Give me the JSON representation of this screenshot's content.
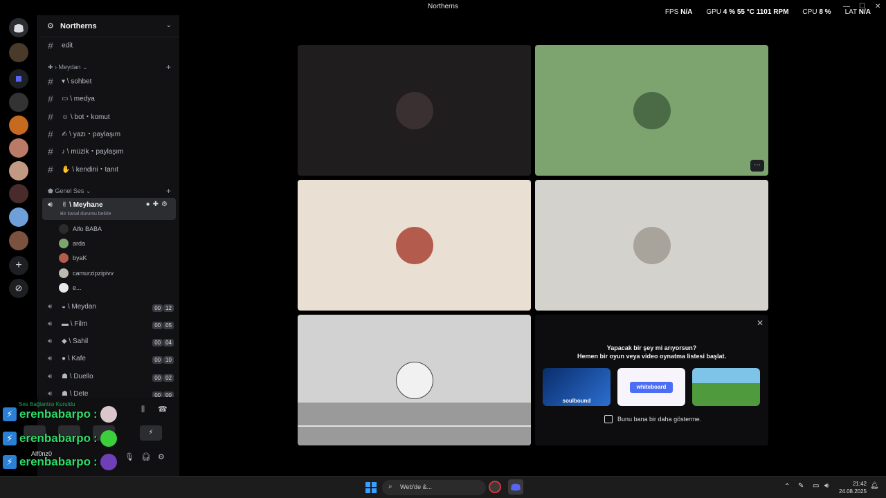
{
  "window": {
    "title": "Northerns"
  },
  "overlay": {
    "fps_label": "FPS",
    "fps_value": "N/A",
    "gpu_label": "GPU",
    "gpu_pct": "4 %",
    "gpu_temp": "55 °C",
    "gpu_rpm": "1101 RPM",
    "cpu_label": "CPU",
    "cpu_pct": "8 %",
    "lat_label": "LAT",
    "lat_value": "N/A"
  },
  "server": {
    "name": "Northerns"
  },
  "channels_top": [
    {
      "label": "edit"
    }
  ],
  "categories": [
    {
      "label": "Meydan"
    },
    {
      "label": "Genel Ses"
    }
  ],
  "text_channels": [
    {
      "label": "sohbet"
    },
    {
      "label": "medya"
    },
    {
      "label": "bot・komut"
    },
    {
      "label": "yazı・paylaşım"
    },
    {
      "label": "müzik・paylaşım"
    },
    {
      "label": "kendini・tanıt"
    }
  ],
  "active_voice": {
    "label": "Meyhane",
    "status": "Bir kanal durumu belirle"
  },
  "members": [
    {
      "name": "Alfo BABA"
    },
    {
      "name": "arda"
    },
    {
      "name": "byaK"
    },
    {
      "name": "camurzipzipivv"
    },
    {
      "name": "e..."
    }
  ],
  "voice_channels": [
    {
      "label": "Meydan",
      "a": "00",
      "b": "12"
    },
    {
      "label": "Film",
      "a": "00",
      "b": "05"
    },
    {
      "label": "Sahil",
      "a": "00",
      "b": "04"
    },
    {
      "label": "Kafe",
      "a": "00",
      "b": "10"
    },
    {
      "label": "Duello",
      "a": "00",
      "b": "02"
    },
    {
      "label": "Dete",
      "a": "00",
      "b": "00"
    }
  ],
  "connection": {
    "status": "Ses Bağlantısı Kuruldu"
  },
  "user": {
    "name": "Alf0nz0"
  },
  "chat_overlay": [
    {
      "name": "erenbabarpo",
      "sep": ":"
    },
    {
      "name": "erenbabarpo",
      "sep": ":"
    },
    {
      "name": "erenbabarpo",
      "sep": ":"
    },
    {
      "name": "erenbabarpo",
      "sep": ":"
    }
  ],
  "activity_panel": {
    "line1": "Yapacak bir şey mi arıyorsun?",
    "line2": "Hemen bir oyun veya video oynatma listesi başlat.",
    "cards": [
      {
        "label": "soulbound"
      },
      {
        "label": "whiteboard"
      },
      {
        "label": ""
      }
    ],
    "checkbox_label": "Bunu bana bir daha gösterme."
  },
  "taskbar": {
    "search_placeholder": "Web'de &...",
    "time": "21:42",
    "date": "24.08.2025"
  },
  "colors": {
    "accent": "#5865f2",
    "tile_green": "#7da46f",
    "tile_cream": "#eadfd3",
    "tile_gray": "#d4d2cd"
  }
}
